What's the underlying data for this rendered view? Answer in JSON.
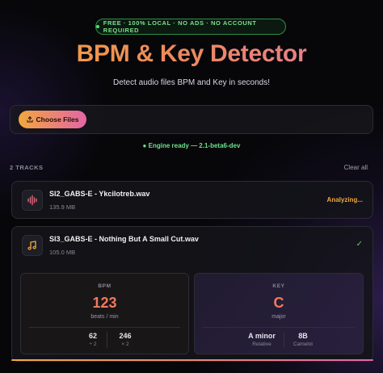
{
  "badge": {
    "text": "FREE · 100% LOCAL · NO ADS · NO ACCOUNT REQUIRED"
  },
  "header": {
    "title": "BPM & Key Detector",
    "subtitle": "Detect audio files BPM and Key in seconds!"
  },
  "dropzone": {
    "button_label": "Choose Files"
  },
  "engine_status": "Engine ready — 2.1-beta6-dev",
  "tracks": {
    "count_label": "2 TRACKS",
    "clear_label": "Clear all",
    "items": [
      {
        "name": "Sl2_GABS-E - Ykcilotreb.wav",
        "size": "135.9 MB",
        "status": "Analyzing..."
      },
      {
        "name": "Sl3_GABS-E - Nothing But A Small Cut.wav",
        "size": "105.0 MB",
        "status": "✓",
        "bpm": {
          "label": "BPM",
          "value": "123",
          "unit": "beats / min",
          "half": "62",
          "half_label": "÷ 2",
          "double": "246",
          "double_label": "× 2"
        },
        "key": {
          "label": "KEY",
          "value": "C",
          "mode": "major",
          "relative": "A minor",
          "relative_label": "Relative",
          "camelot": "8B",
          "camelot_label": "Camelot"
        }
      }
    ]
  },
  "colors": {
    "accent_orange": "#f2a83e",
    "accent_pink": "#e366a6",
    "ready_green": "#6fe08a",
    "value_coral": "#ee7a5e"
  },
  "icons": {
    "badge": "status-dot-icon",
    "choose": "upload-icon",
    "track1": "waveform-icon",
    "track2": "music-note-icon"
  }
}
